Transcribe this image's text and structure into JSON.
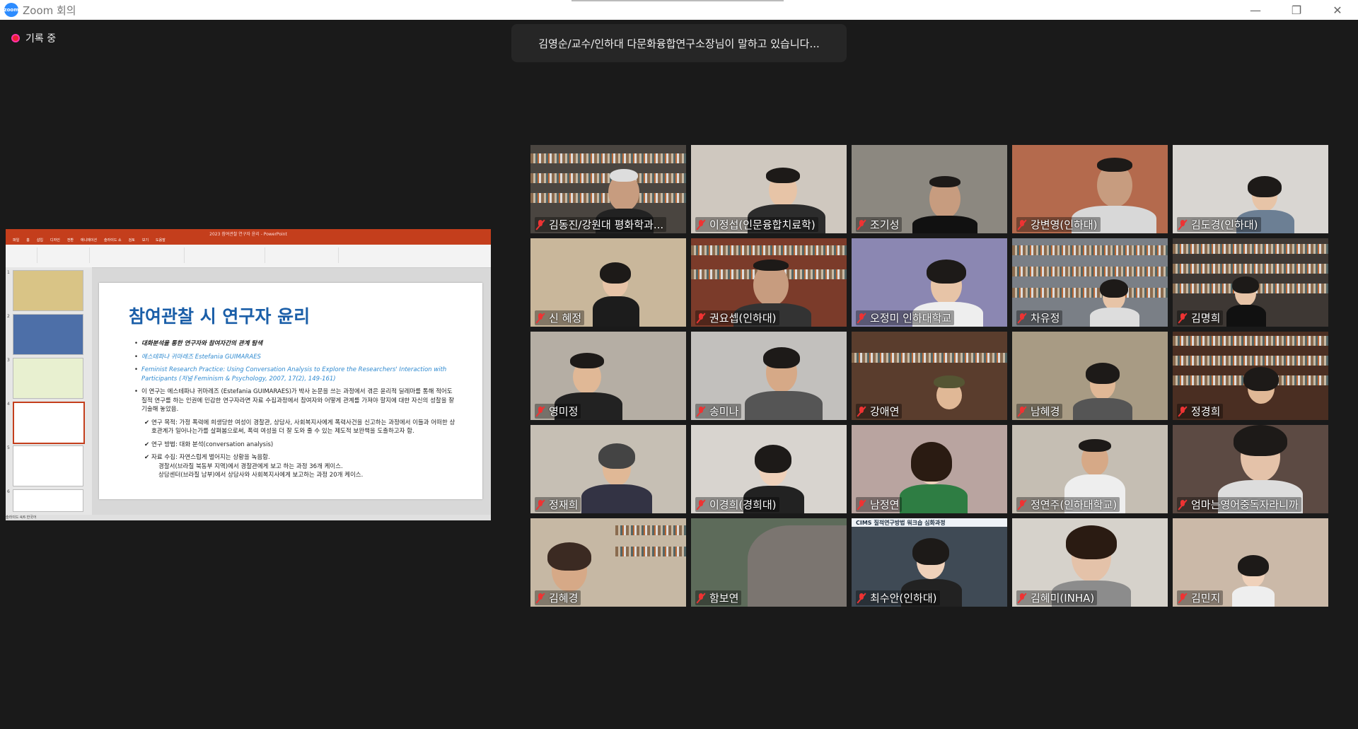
{
  "window": {
    "title": "Zoom 회의"
  },
  "recording": {
    "label": "기록 중"
  },
  "speaking_banner": "김영순/교수/인하대 다문화융합연구소장님이 말하고 있습니다...",
  "shared_screen": {
    "app_title": "2023 참여관찰 연구자 윤리 - PowerPoint",
    "ribbon_tabs": [
      "파일",
      "홈",
      "삽입",
      "디자인",
      "전환",
      "애니메이션",
      "슬라이드 쇼",
      "검토",
      "보기",
      "도움말"
    ],
    "slide_title": "참여관찰 시 연구자 윤리",
    "bullets": {
      "b1": "대화분석을 통한 연구자와 참여자간의 관계 탐색",
      "b2": "에스테파냐 귀마레즈 Estefania GUIMARAES",
      "b3": "Feminist Research Practice: Using Conversation Analysis to Explore the Researchers' Interaction with Participants (저널 Feminism & Psychology, 2007, 17(2), 149-161)",
      "b4": "이 연구는 에스테파냐 귀마레즈 (Estefania GUIMARAES)가 박사 논문을 쓰는 과정에서 겪은 윤리적 딜레마를 통해 적어도 질적 연구를 하는 인권에 민감한 연구자라면 자료 수집과정에서 참여자와 어떻게 관계를 가져야 할지에 대한 자신의 성찰을 잘 기술해 놓았음.",
      "c1": "연구 목적: 가정 폭력에 희생당한 여성이 경찰관, 상담사, 사회복지사에게 폭력사건을 신고하는 과정에서 이들과 어떠한 상호관계가 일어나는가를 살펴봄으로써, 폭력 여성을 더 잘 도와 줄 수 있는 제도적 보완책을 도출하고자 함.",
      "c2": "연구 방법: 대화 분석(conversation analysis)",
      "c3": "자료 수집: 자연스럽게 벌어지는 상황을 녹음함.",
      "d1": "경찰서(브라질 북동부 지역)에서 경찰관에게 보고 하는 과정 36개 케이스.",
      "d2": "상담센터(브라질 남부)에서 상담사와 사회복지사에게 보고하는 과정 20개 케이스."
    },
    "status_bar": "슬라이드 4/6  한국어"
  },
  "participants": [
    {
      "name": "김동진/강원대 평화학과..."
    },
    {
      "name": "이정섭(인문융합치료학)"
    },
    {
      "name": "조기성"
    },
    {
      "name": "강변영(인하대)"
    },
    {
      "name": "김도경(인하대)"
    },
    {
      "name": "신 혜정"
    },
    {
      "name": "권요셉(인하대)"
    },
    {
      "name": "오정미 인하대학교"
    },
    {
      "name": "차유정"
    },
    {
      "name": "김명희"
    },
    {
      "name": "영미정"
    },
    {
      "name": "송미나"
    },
    {
      "name": "강애연"
    },
    {
      "name": "남혜경"
    },
    {
      "name": "정경희"
    },
    {
      "name": "정재희"
    },
    {
      "name": "이경희(경희대)"
    },
    {
      "name": "남정연"
    },
    {
      "name": "정연주(인하대학교)"
    },
    {
      "name": "엄마는영어중독자라니까"
    },
    {
      "name": "김혜경"
    },
    {
      "name": "함보연"
    },
    {
      "name": "최수안(인하대)"
    },
    {
      "name": "김혜미(INHA)"
    },
    {
      "name": "김민지"
    }
  ],
  "tile_banner": "CIMS 질적연구방법 워크숍 심화과정"
}
